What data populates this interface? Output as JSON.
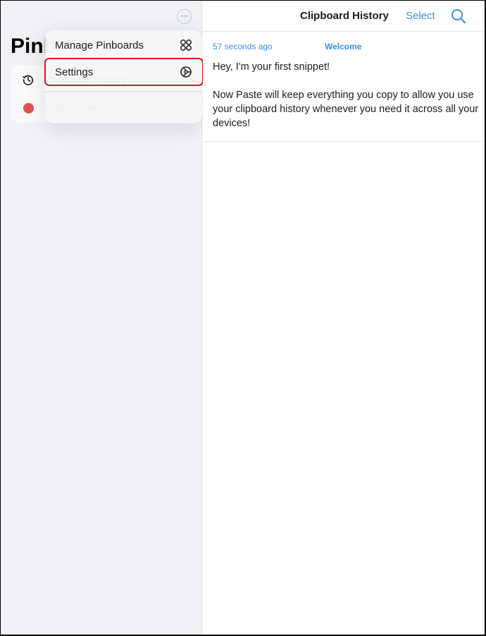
{
  "sidebar": {
    "title": "Pinboards",
    "title_visible": "Pinl",
    "more_icon": "ellipsis-circle-icon",
    "items": [
      {
        "icon": "history-icon",
        "label": "Clipboard History"
      },
      {
        "icon": "red-dot",
        "label": "Useful Links",
        "color": "#e05252",
        "chevron": "chevron-right-icon"
      }
    ]
  },
  "menu": {
    "items": [
      {
        "label": "Manage Pinboards",
        "icon": "grid-circles-icon"
      },
      {
        "label": "Settings",
        "icon": "gear-icon",
        "highlighted": true
      }
    ]
  },
  "header": {
    "title": "Clipboard History",
    "select_label": "Select",
    "search_icon": "search-icon"
  },
  "snippets": [
    {
      "time": "57 seconds ago",
      "tag": "Welcome",
      "body": "Hey, I'm your first snippet!\n\nNow Paste will keep everything you copy to allow you use your clipboard history whenever you need it across all your devices!"
    }
  ],
  "colors": {
    "accent": "#3a8ee6",
    "highlight": "#e0141e",
    "pinboard_red": "#e05252"
  }
}
